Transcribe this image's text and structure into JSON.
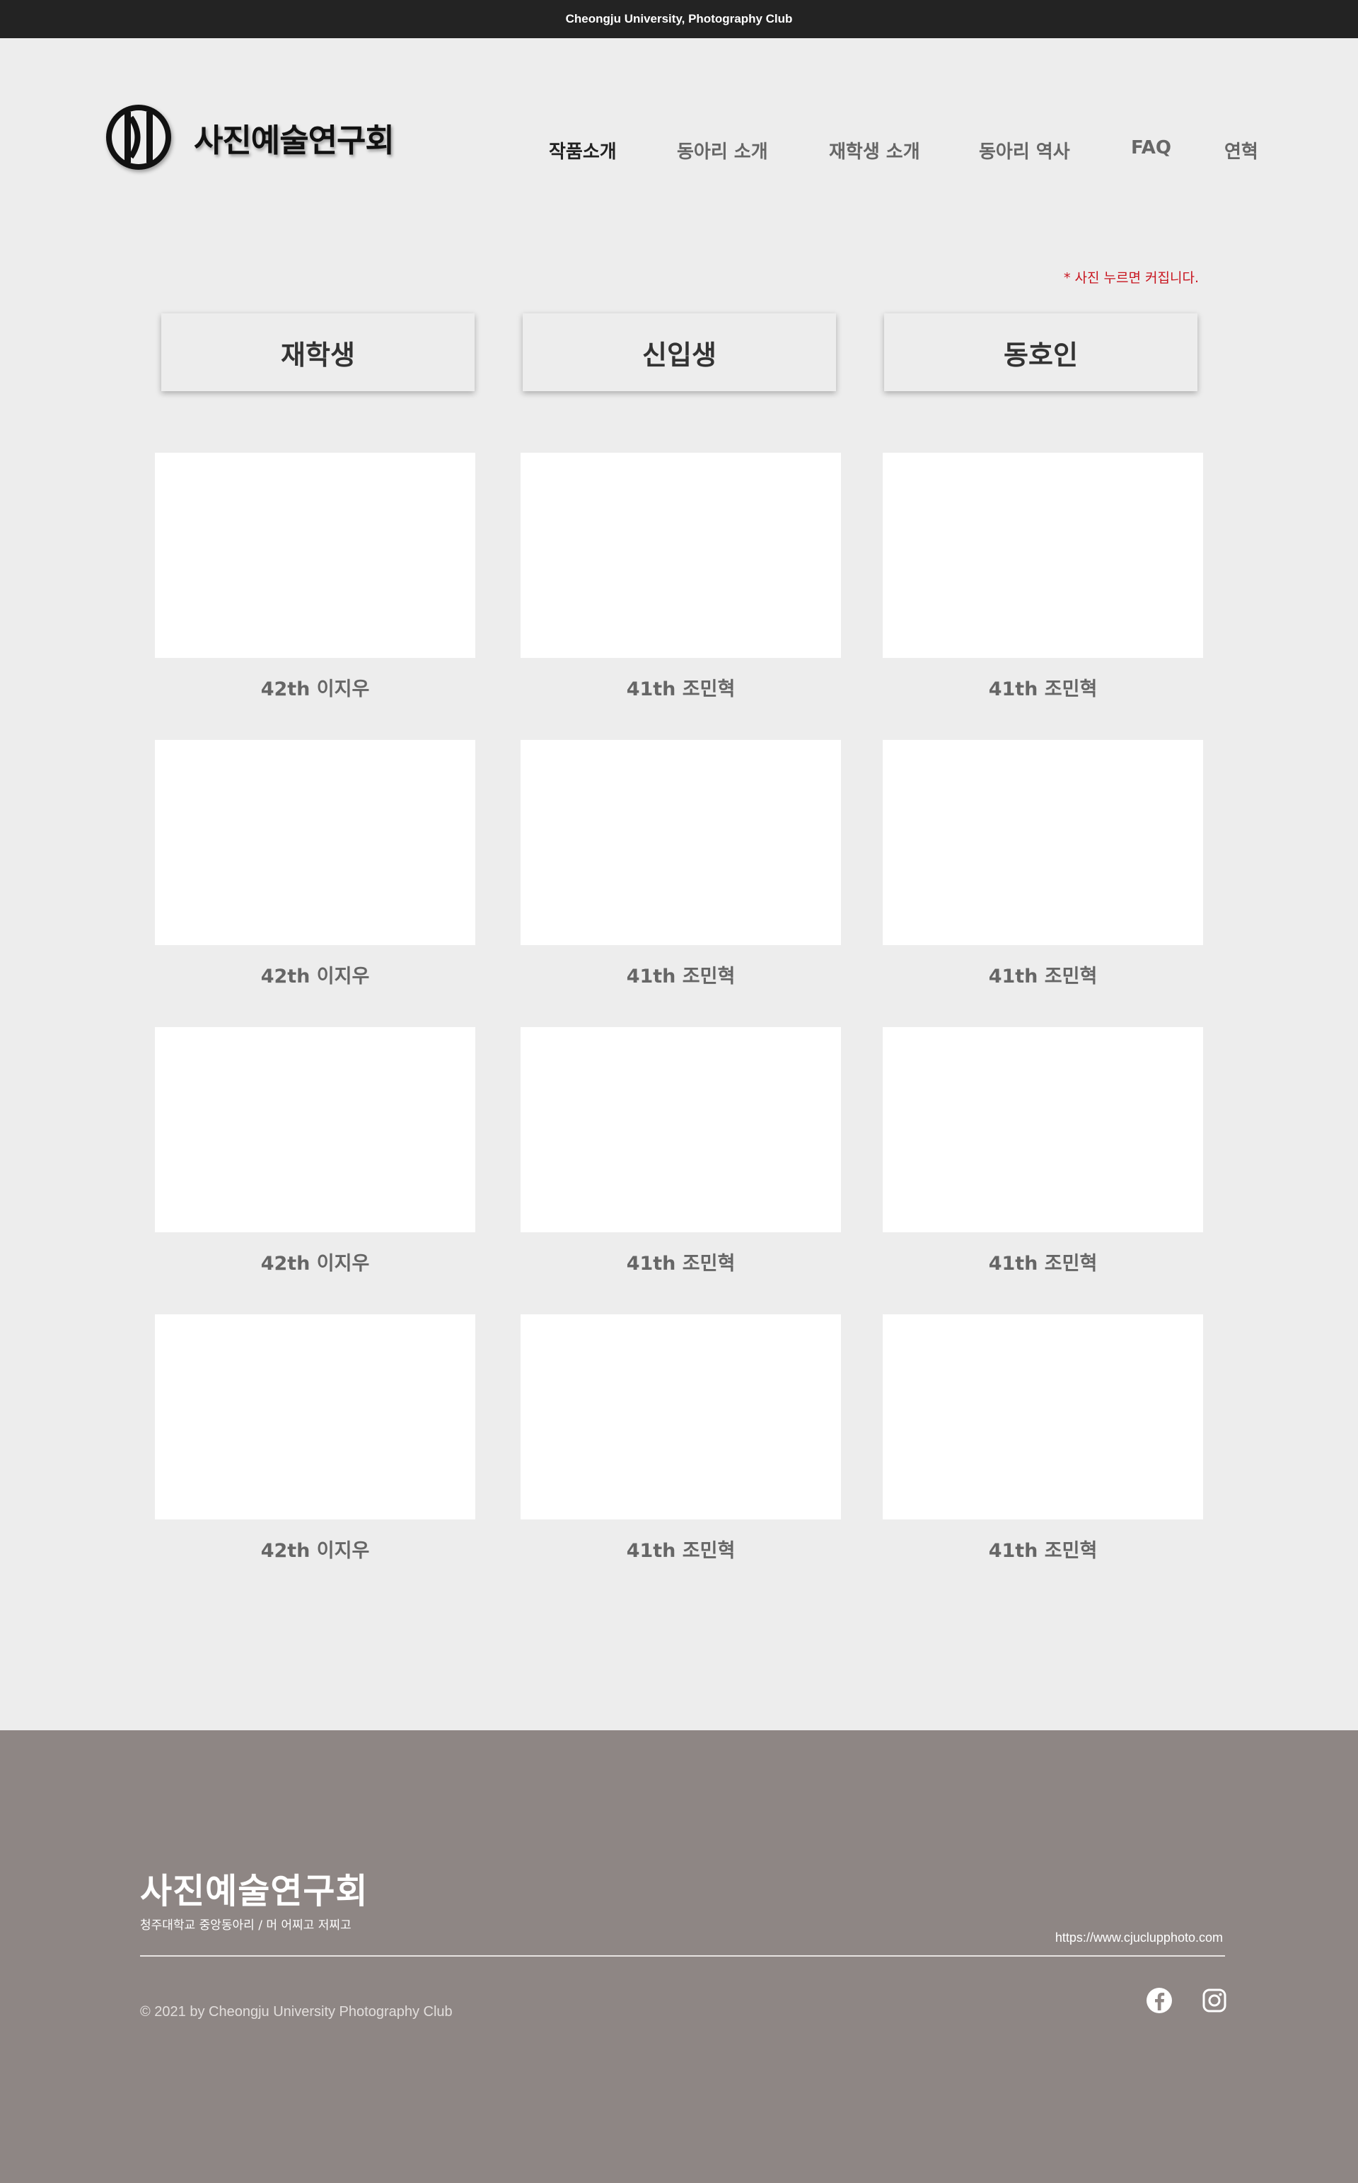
{
  "topbar": {
    "text": "Cheongju University,  Photography Club"
  },
  "logo": {
    "text": "사진예술연구회"
  },
  "nav": {
    "items": [
      {
        "label": "작품소개",
        "active": true
      },
      {
        "label": "동아리 소개",
        "active": false
      },
      {
        "label": "재학생 소개",
        "active": false
      },
      {
        "label": "동아리 역사",
        "active": false
      },
      {
        "label": "FAQ",
        "active": false
      },
      {
        "label": "연혁",
        "active": false
      }
    ]
  },
  "hint": "* 사진 누르면 커집니다.",
  "categories": [
    "재학생",
    "신입생",
    "동호인"
  ],
  "gallery": {
    "rows": [
      [
        "42th 이지우",
        "41th 조민혁",
        "41th 조민혁"
      ],
      [
        "42th 이지우",
        "41th 조민혁",
        "41th 조민혁"
      ],
      [
        "42th 이지우",
        "41th 조민혁",
        "41th 조민혁"
      ],
      [
        "42th 이지우",
        "41th 조민혁",
        "41th 조민혁"
      ]
    ]
  },
  "footer": {
    "title": "사진예술연구회",
    "subtitle": "청주대학교 중앙동아리 / 머 어찌고 저찌고",
    "url": "https://www.cjuclupphoto.com",
    "copyright": "© 2021 by Cheongju University Photography Club",
    "social": [
      "facebook-icon",
      "instagram-icon"
    ]
  },
  "colors": {
    "topbar": "#232323",
    "page_bg": "#ededed",
    "footer_bg": "#8e8684",
    "hint": "#c8141e"
  }
}
